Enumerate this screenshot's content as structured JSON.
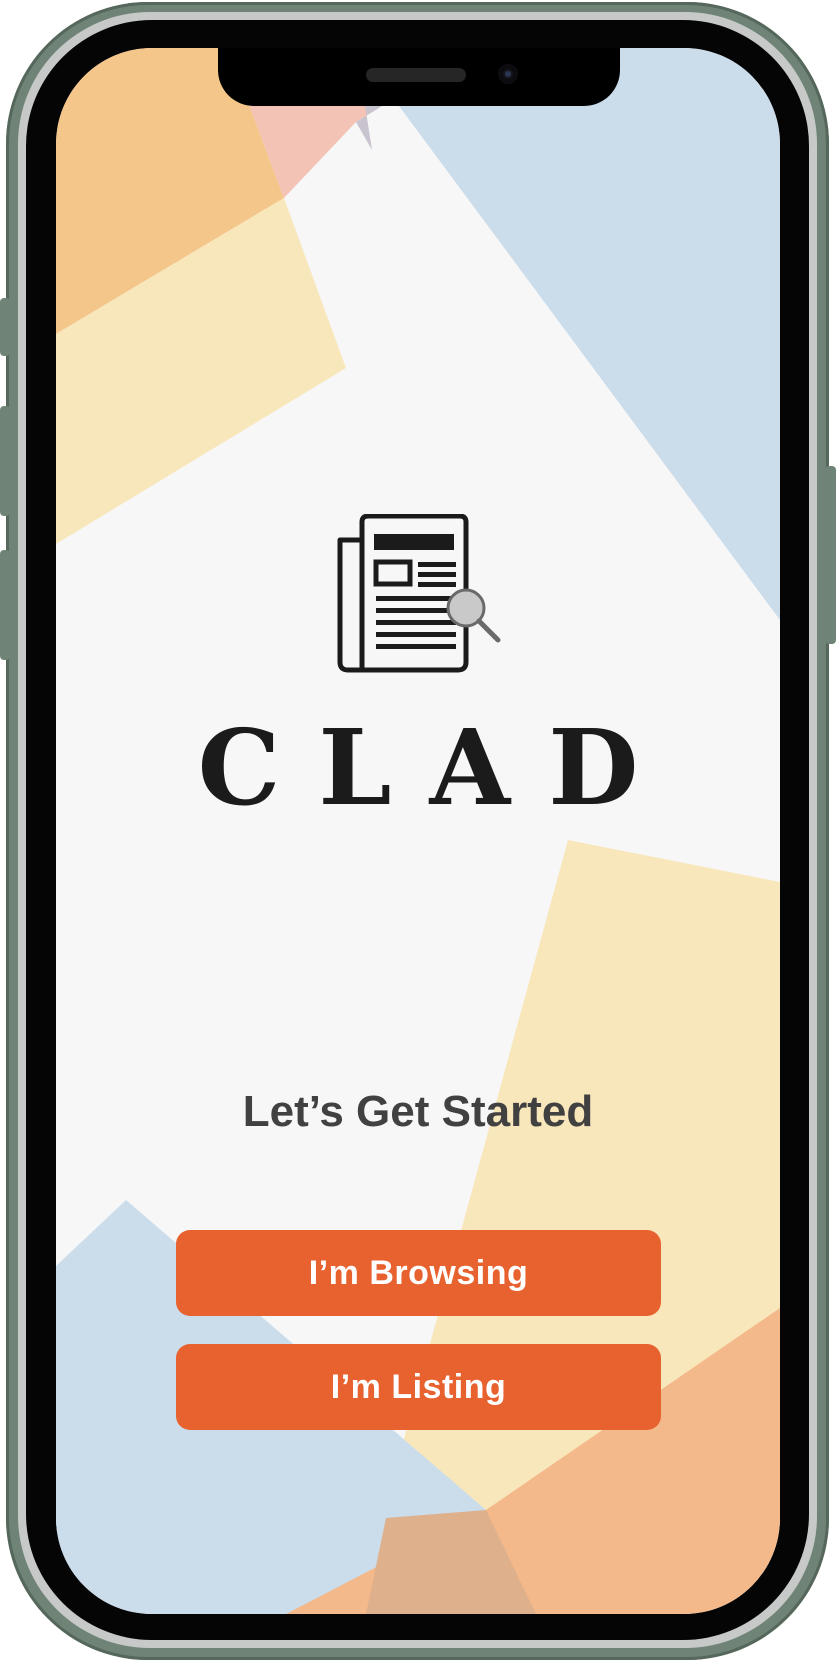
{
  "app": {
    "brand_name": "CLAD",
    "logo_icon": "newspaper-search-icon"
  },
  "onboarding": {
    "headline": "Let’s Get Started",
    "browse_button_label": "I’m Browsing",
    "listing_button_label": "I’m Listing"
  },
  "colors": {
    "accent": "#E8622F",
    "screen_background": "#F7F7F7",
    "shape_orange": "#F5C68A",
    "shape_pink": "#F3C3B6",
    "shape_blue": "#CBDCEB",
    "shape_yellow": "#F9E7BC",
    "shape_peach": "#F3B98A",
    "frame": "#6F8476"
  }
}
